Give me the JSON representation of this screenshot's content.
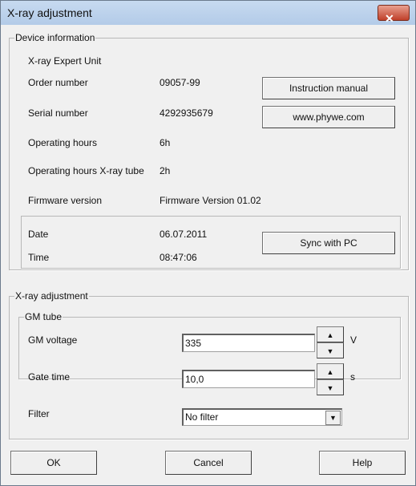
{
  "window": {
    "title": "X-ray adjustment",
    "close_icon": "close-icon"
  },
  "device": {
    "legend": "Device information",
    "unit": "X-ray Expert Unit",
    "rows": [
      {
        "label": "Order number",
        "value": "09057-99"
      },
      {
        "label": "Serial number",
        "value": "4292935679"
      },
      {
        "label": "Operating hours",
        "value": "6h"
      },
      {
        "label": "Operating hours X-ray tube",
        "value": "2h"
      },
      {
        "label": "Firmware version",
        "value": "Firmware Version 01.02"
      }
    ],
    "instruction_manual": "Instruction manual",
    "website": "www.phywe.com",
    "date_label": "Date",
    "date_value": "06.07.2011",
    "time_label": "Time",
    "time_value": "08:47:06",
    "sync": "Sync with PC"
  },
  "xray": {
    "legend": "X-ray adjustment",
    "gm_legend": "GM tube",
    "gm_voltage_label": "GM voltage",
    "gm_voltage": "335",
    "gm_voltage_unit": "V",
    "gate_time_label": "Gate time",
    "gate_time": "10,0",
    "gate_time_unit": "s",
    "filter_label": "Filter",
    "filter_value": "No filter"
  },
  "buttons": {
    "ok": "OK",
    "cancel": "Cancel",
    "help": "Help"
  }
}
